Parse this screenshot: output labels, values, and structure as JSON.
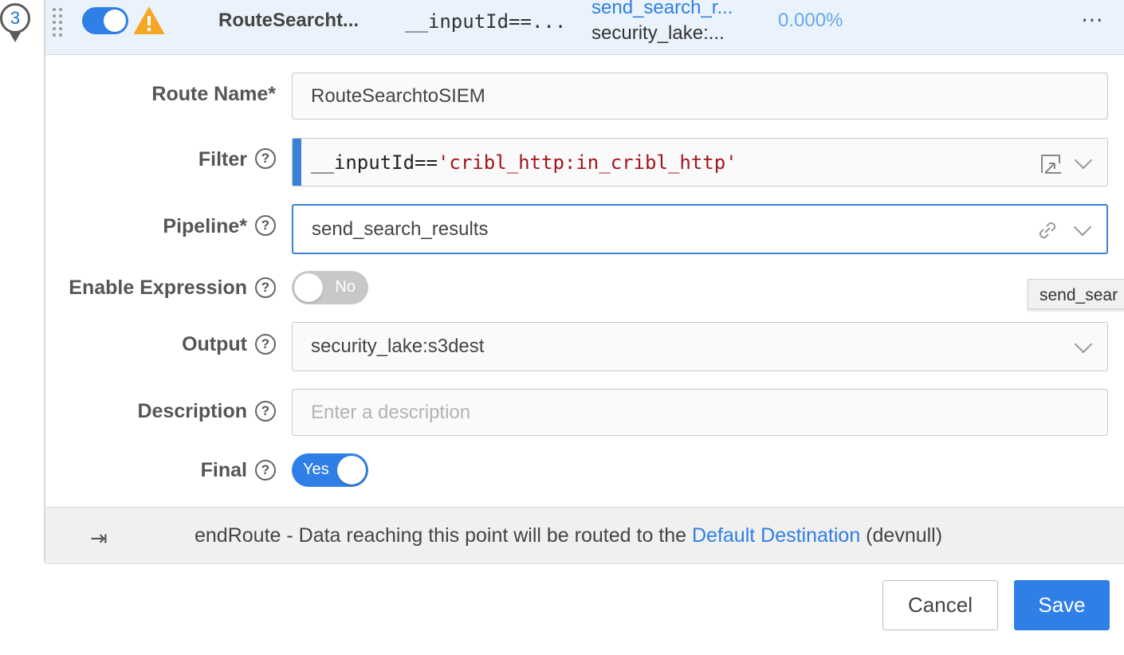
{
  "route": {
    "number": "3",
    "header": {
      "name": "RouteSearcht...",
      "filter": "__inputId==...",
      "pipeline": "send_search_r...",
      "output": "security_lake:...",
      "percent": "0.000%"
    }
  },
  "form": {
    "route_name": {
      "label": "Route Name*",
      "value": "RouteSearchtoSIEM"
    },
    "filter": {
      "label": "Filter",
      "code_prefix": "__inputId==",
      "code_string": "'cribl_http:in_cribl_http'"
    },
    "pipeline": {
      "label": "Pipeline*",
      "value": "send_search_results"
    },
    "enable_expression": {
      "label": "Enable Expression",
      "state": "No"
    },
    "output": {
      "label": "Output",
      "value": "security_lake:s3dest"
    },
    "description": {
      "label": "Description",
      "placeholder": "Enter a description"
    },
    "final": {
      "label": "Final",
      "state": "Yes"
    }
  },
  "tooltip": {
    "text": "send_sear"
  },
  "end_route": {
    "prefix": "endRoute - Data reaching this point will be routed to the ",
    "link": "Default Destination",
    "suffix": " (devnull)"
  },
  "footer": {
    "cancel_label": "Cancel",
    "save_label": "Save"
  },
  "colors": {
    "accent": "#2f7fe6",
    "warning": "#f5a623",
    "filter_string": "#a3151d"
  },
  "icons": {
    "drag": "drag-handle-icon",
    "warning": "warning-icon",
    "more": "more-icon",
    "help": "help-icon",
    "expand": "expand-editor-icon",
    "link": "link-icon",
    "chevron": "chevron-down-icon",
    "end_route": "end-route-icon"
  }
}
